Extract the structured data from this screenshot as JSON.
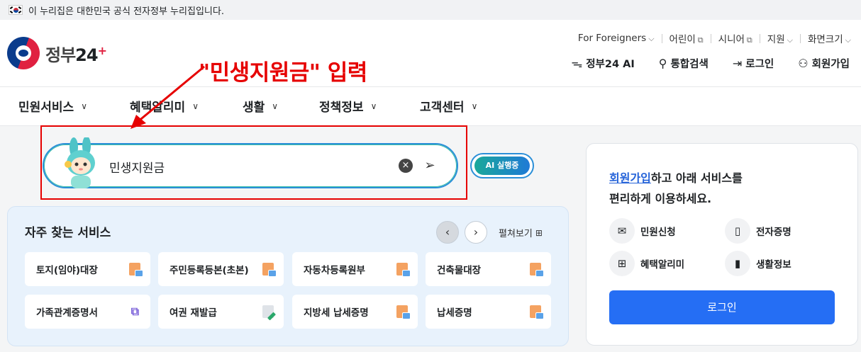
{
  "gov_banner": {
    "text": "이 누리집은 대한민국 공식 전자정부 누리집입니다."
  },
  "logo": {
    "name": "정부",
    "number": "24"
  },
  "utility_links": [
    {
      "label": "For Foreigners",
      "icon": "chevron-down-icon"
    },
    {
      "label": "어린이",
      "icon": "external-link-icon"
    },
    {
      "label": "시니어",
      "icon": "external-link-icon"
    },
    {
      "label": "지원",
      "icon": "chevron-down-icon"
    },
    {
      "label": "화면크기",
      "icon": "chevron-down-icon"
    }
  ],
  "main_actions": [
    {
      "label": "정부24 AI",
      "icon": "ai-mascot-icon"
    },
    {
      "label": "통합검색",
      "icon": "search-icon"
    },
    {
      "label": "로그인",
      "icon": "login-icon"
    },
    {
      "label": "회원가입",
      "icon": "add-user-icon"
    }
  ],
  "nav": [
    {
      "label": "민원서비스"
    },
    {
      "label": "혜택알리미"
    },
    {
      "label": "생활"
    },
    {
      "label": "정책정보"
    },
    {
      "label": "고객센터"
    }
  ],
  "annotation": {
    "text": "\"민생지원금\" 입력",
    "color": "#e60000"
  },
  "search": {
    "value": "민생지원금"
  },
  "ai_badge": {
    "label": "AI 실행중"
  },
  "favorites": {
    "title": "자주 찾는 서비스",
    "unfold_label": "펼쳐보기",
    "items": [
      {
        "label": "토지(임야)대장",
        "icon": "document-icon"
      },
      {
        "label": "주민등록등본(초본)",
        "icon": "document-icon"
      },
      {
        "label": "자동차등록원부",
        "icon": "document-icon"
      },
      {
        "label": "건축물대장",
        "icon": "document-icon"
      },
      {
        "label": "가족관계증명서",
        "icon": "external-link-icon"
      },
      {
        "label": "여권 재발급",
        "icon": "edit-document-icon"
      },
      {
        "label": "지방세 납세증명",
        "icon": "document-icon"
      },
      {
        "label": "납세증명",
        "icon": "document-icon"
      }
    ]
  },
  "member_panel": {
    "link_text": "회원가입",
    "message_rest": "하고 아래 서비스를",
    "message_line2": "편리하게 이용하세요.",
    "services": [
      {
        "label": "민원신청",
        "icon": "mail-icon"
      },
      {
        "label": "전자증명",
        "icon": "certificate-icon"
      },
      {
        "label": "혜택알리미",
        "icon": "gift-icon"
      },
      {
        "label": "생활정보",
        "icon": "bookmark-icon"
      }
    ],
    "login_label": "로그인"
  },
  "colors": {
    "primary": "#256ef4",
    "link": "#2563d9",
    "annotation": "#e60000",
    "panel_bg": "#e8f2fc"
  }
}
